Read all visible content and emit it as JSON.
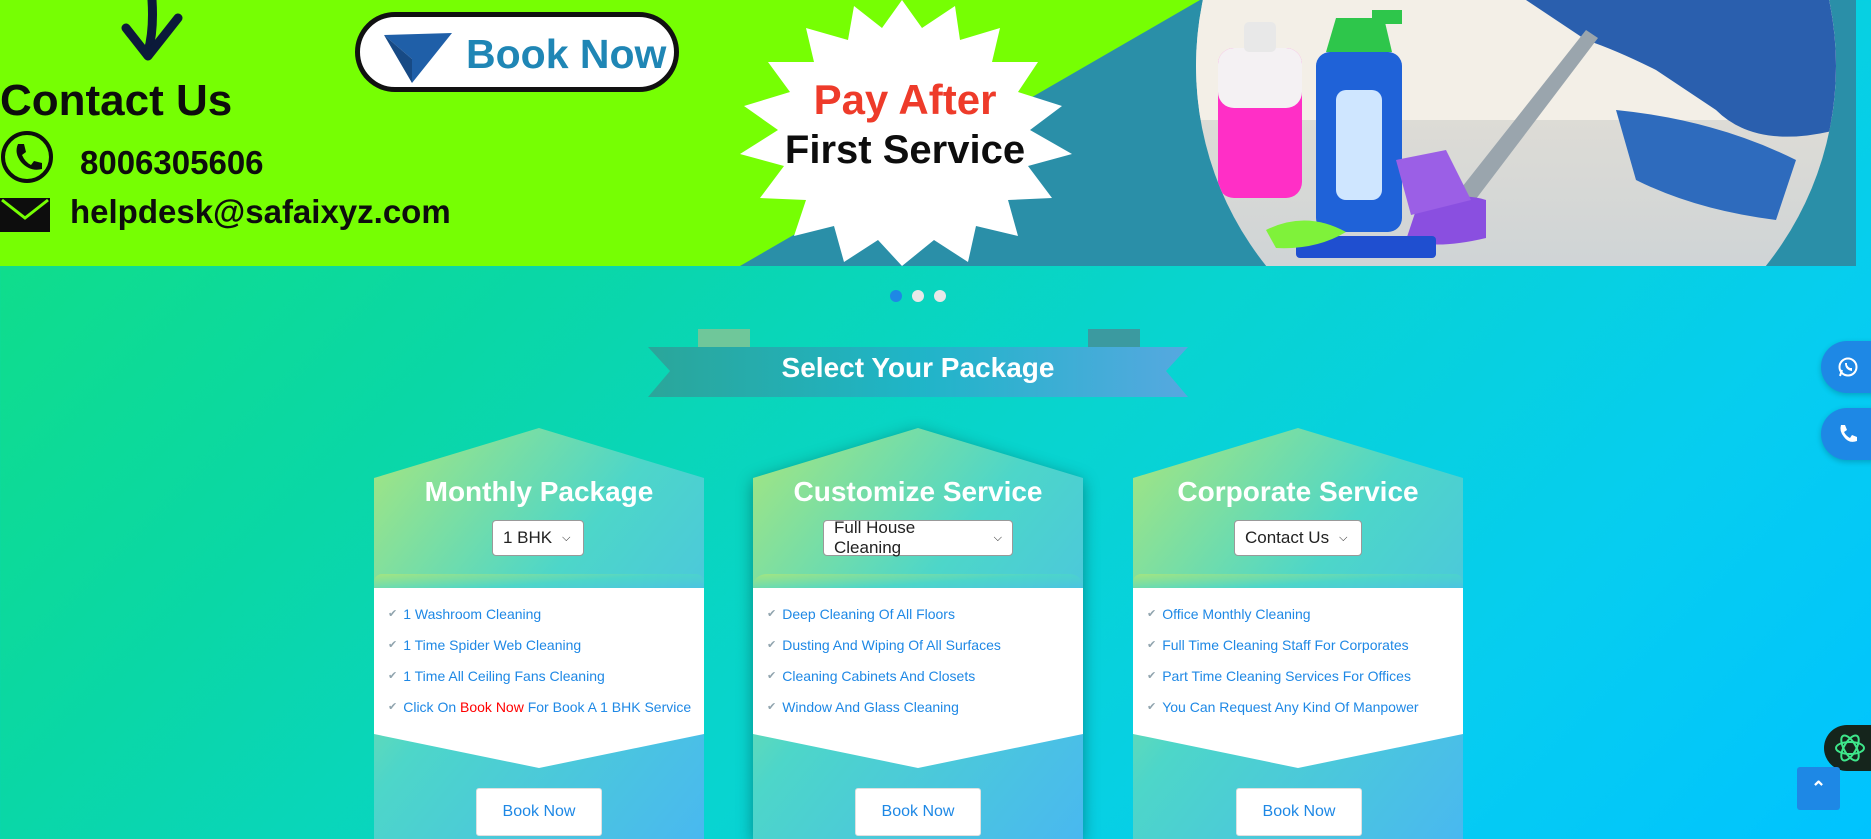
{
  "banner": {
    "book_now_label": "Book Now",
    "contact_title": "Contact Us",
    "phone": "8006305606",
    "email": "helpdesk@safaixyz.com",
    "promo_line1": "Pay After",
    "promo_line2": "First Service",
    "colors": {
      "lime": "#76ff03",
      "teal": "#2a8fa8",
      "promo_red": "#ee3b2a",
      "book_blue": "#1f86b5"
    }
  },
  "carousel": {
    "active_index": 0,
    "count": 3
  },
  "section_title": "Select Your Package",
  "packages": [
    {
      "title": "Monthly Package",
      "selected": "1 BHK",
      "features": [
        {
          "text": "1 Washroom Cleaning"
        },
        {
          "text": "1 Time Spider Web Cleaning"
        },
        {
          "text": "1 Time All Ceiling Fans Cleaning"
        },
        {
          "pre": "Click On ",
          "highlight": "Book Now",
          "post": " For Book A 1 BHK Service"
        }
      ],
      "button": "Book Now"
    },
    {
      "title": "Customize Service",
      "selected": "Full House Cleaning",
      "features": [
        {
          "text": "Deep Cleaning Of All Floors"
        },
        {
          "text": "Dusting And Wiping Of All Surfaces"
        },
        {
          "text": "Cleaning Cabinets And Closets"
        },
        {
          "text": "Window And Glass Cleaning"
        }
      ],
      "button": "Book Now"
    },
    {
      "title": "Corporate Service",
      "selected": "Contact Us",
      "features": [
        {
          "text": "Office Monthly Cleaning"
        },
        {
          "text": "Full Time Cleaning Staff For Corporates"
        },
        {
          "text": "Part Time Cleaning Services For Offices"
        },
        {
          "text": "You Can Request Any Kind Of Manpower"
        }
      ],
      "button": "Book Now"
    }
  ],
  "floating": {
    "whatsapp_icon": "whatsapp-icon",
    "phone_icon": "phone-icon",
    "ai_icon": "ai-assistant-icon",
    "top_icon": "double-chevron-up-icon"
  },
  "colors": {
    "accent": "#1e88e5",
    "highlight_red": "#ff0000"
  }
}
